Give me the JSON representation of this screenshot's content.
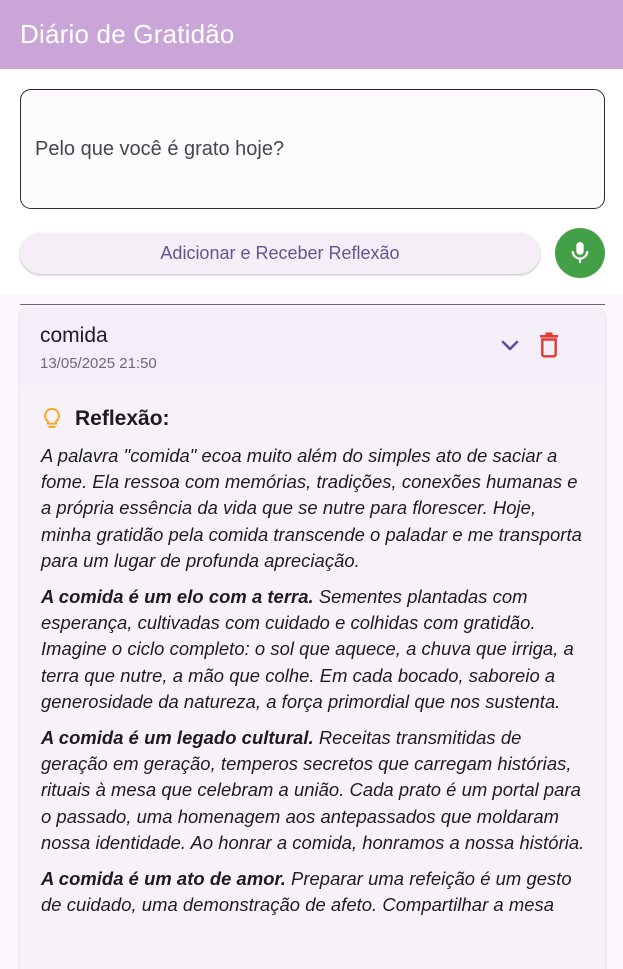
{
  "app": {
    "title": "Diário de Gratidão"
  },
  "input": {
    "placeholder": "Pelo que você é grato hoje?"
  },
  "actions": {
    "add_label": "Adicionar e Receber Reflexão",
    "mic_icon": "mic-icon"
  },
  "entry": {
    "title": "comida",
    "date": "13/05/2025 21:50",
    "reflection_label": "Reflexão:",
    "paragraphs": [
      {
        "lead": "",
        "text": "A palavra \"comida\" ecoa muito além do simples ato de saciar a fome. Ela ressoa com memórias, tradições, conexões humanas e a própria essência da vida que se nutre para florescer. Hoje, minha gratidão pela comida transcende o paladar e me transporta para um lugar de profunda apreciação."
      },
      {
        "lead": "A comida é um elo com a terra.",
        "text": " Sementes plantadas com esperança, cultivadas com cuidado e colhidas com gratidão. Imagine o ciclo completo: o sol que aquece, a chuva que irriga, a terra que nutre, a mão que colhe. Em cada bocado, saboreio a generosidade da natureza, a força primordial que nos sustenta."
      },
      {
        "lead": "A comida é um legado cultural.",
        "text": " Receitas transmitidas de geração em geração, temperos secretos que carregam histórias, rituais à mesa que celebram a união. Cada prato é um portal para o passado, uma homenagem aos antepassados que moldaram nossa identidade. Ao honrar a comida, honramos a nossa história."
      },
      {
        "lead": "A comida é um ato de amor.",
        "text": " Preparar uma refeição é um gesto de cuidado, uma demonstração de afeto. Compartilhar a mesa"
      }
    ]
  },
  "colors": {
    "appbar": "#c9a5d8",
    "mic_button": "#43a047",
    "delete_icon": "#e53935",
    "bulb_icon": "#f9a825",
    "chevron": "#5b4f9a"
  }
}
